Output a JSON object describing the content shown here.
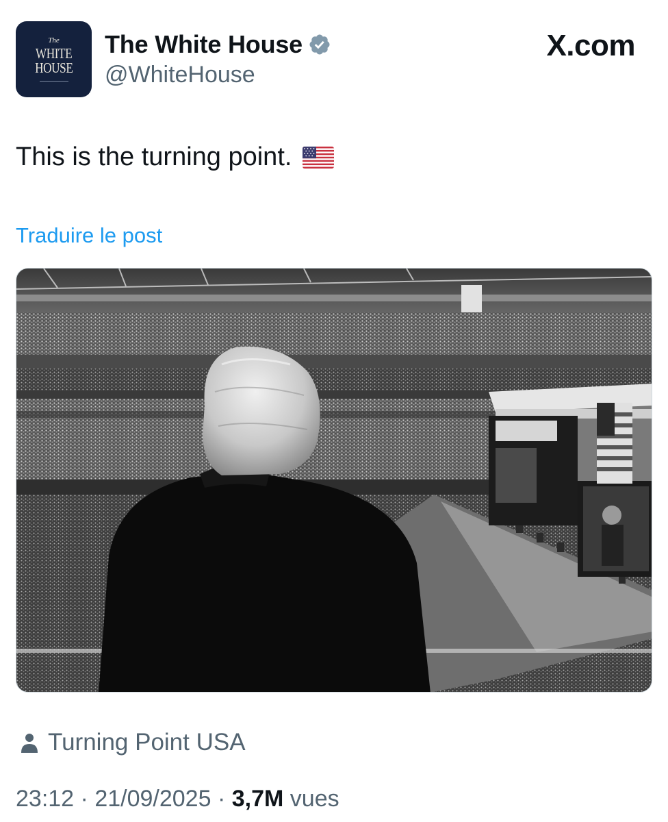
{
  "author": {
    "display_name": "The White House",
    "handle": "@WhiteHouse",
    "verified": true,
    "avatar": {
      "line_the": "The",
      "line_white": "WHITE",
      "line_house": "HOUSE"
    }
  },
  "brand": "X.com",
  "post": {
    "text": "This is the turning point.",
    "emoji": "us-flag",
    "translate_label": "Traduire le post",
    "media": {
      "kind": "photo",
      "style": "black-and-white"
    }
  },
  "location": {
    "icon": "person-icon",
    "label": "Turning Point USA"
  },
  "meta": {
    "time": "23:12",
    "separator": "·",
    "date": "21/09/2025",
    "views_count": "3,7M",
    "views_label": "vues"
  },
  "colors": {
    "text_primary": "#0f1419",
    "text_secondary": "#536471",
    "link": "#1d9bf0",
    "verified_badge": "#829aab",
    "avatar_bg": "#14213d"
  }
}
